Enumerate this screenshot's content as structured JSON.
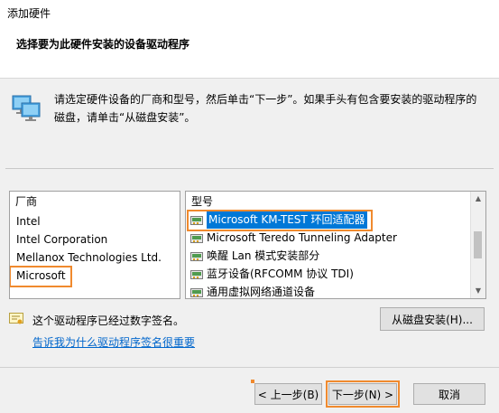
{
  "window": {
    "title": "添加硬件"
  },
  "header": {
    "heading": "选择要为此硬件安装的设备驱动程序"
  },
  "instruction": "请选定硬件设备的厂商和型号，然后单击“下一步”。如果手头有包含要安装的驱动程序的磁盘，请单击“从磁盘安装”。",
  "manufacturers": {
    "header": "厂商",
    "items": [
      "Intel",
      "Intel Corporation",
      "Mellanox Technologies Ltd.",
      "Microsoft"
    ],
    "selected_index": 3
  },
  "models": {
    "header": "型号",
    "items": [
      "Microsoft KM-TEST 环回适配器",
      "Microsoft Teredo Tunneling Adapter",
      "唤醒 Lan 模式安装部分",
      "蓝牙设备(RFCOMM 协议 TDI)",
      "通用虚拟网络通道设备"
    ],
    "selected_index": 0,
    "scroll_position": 0.5
  },
  "signature": {
    "text": "这个驱动程序已经过数字签名。",
    "link": "告诉我为什么驱动程序签名很重要"
  },
  "buttons": {
    "have_disk": "从磁盘安装(H)...",
    "back": "< 上一步(B)",
    "next": "下一步(N) >",
    "cancel": "取消"
  },
  "colors": {
    "selection": "#0078d7",
    "highlight_box": "#f08a2e",
    "link": "#0066cc"
  },
  "icons": {
    "device": "network-computer-icon",
    "model": "network-adapter-icon",
    "signature": "certificate-icon"
  }
}
